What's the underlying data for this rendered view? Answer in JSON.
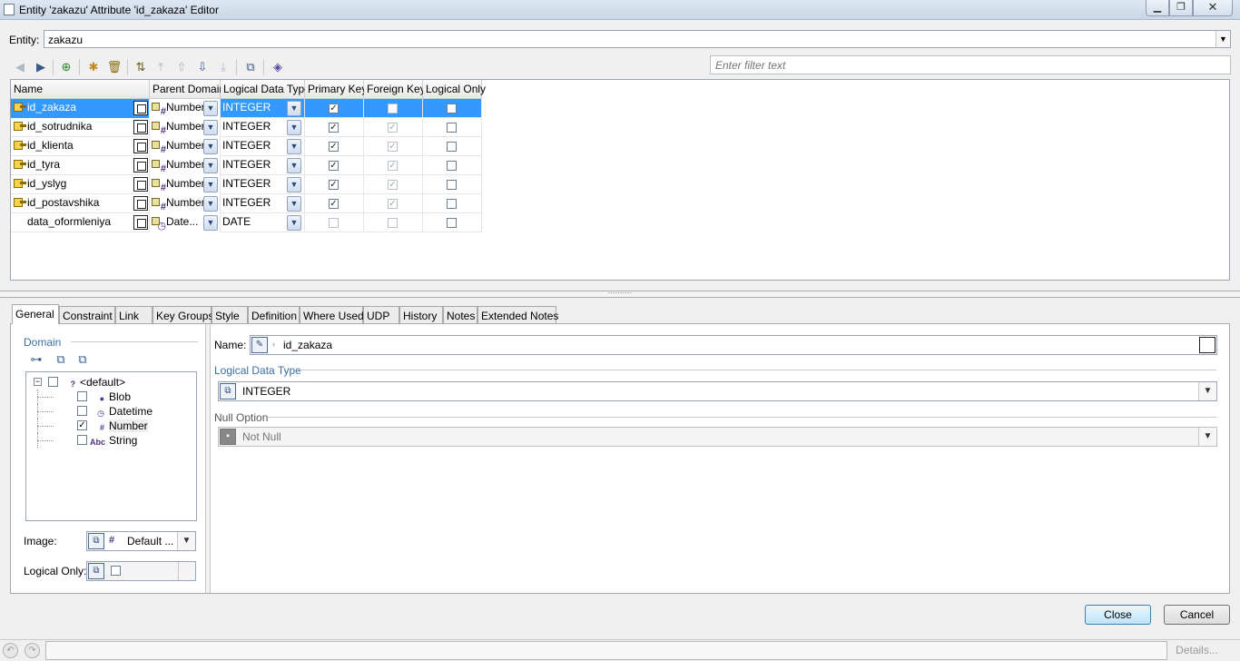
{
  "window": {
    "title": "Entity 'zakazu' Attribute 'id_zakaza' Editor",
    "min_glyph": "▁",
    "max_glyph": "❐",
    "close_glyph": "✕"
  },
  "entity": {
    "label": "Entity:",
    "value": "zakazu"
  },
  "filter": {
    "placeholder": "Enter filter text"
  },
  "grid": {
    "columns": [
      "Name",
      "Parent Domain",
      "Logical Data Type",
      "Primary Key",
      "Foreign Key",
      "Logical Only"
    ],
    "rows": [
      {
        "name": "id_zakaza",
        "domain": "Number",
        "type": "INTEGER",
        "pk": true,
        "fk": false,
        "lo": false,
        "key": true,
        "selected": true
      },
      {
        "name": "id_sotrudnika",
        "domain": "Number",
        "type": "INTEGER",
        "pk": true,
        "fk": true,
        "lo": false,
        "key": true
      },
      {
        "name": "id_klienta",
        "domain": "Number",
        "type": "INTEGER",
        "pk": true,
        "fk": true,
        "lo": false,
        "key": true
      },
      {
        "name": "id_tyra",
        "domain": "Number",
        "type": "INTEGER",
        "pk": true,
        "fk": true,
        "lo": false,
        "key": true
      },
      {
        "name": "id_yslyg",
        "domain": "Number",
        "type": "INTEGER",
        "pk": true,
        "fk": true,
        "lo": false,
        "key": true
      },
      {
        "name": "id_postavshika",
        "domain": "Number",
        "type": "INTEGER",
        "pk": true,
        "fk": true,
        "lo": false,
        "key": true
      },
      {
        "name": "data_oformleniya",
        "domain": "Date...",
        "type": "DATE",
        "pk": false,
        "fk": false,
        "lo": false,
        "key": false
      }
    ]
  },
  "tabs": [
    "General",
    "Constraint",
    "Link",
    "Key Groups",
    "Style",
    "Definition",
    "Where Used",
    "UDP",
    "History",
    "Notes",
    "Extended Notes"
  ],
  "general": {
    "domain_label": "Domain",
    "tree": [
      {
        "label": "<default>",
        "checked": false
      },
      {
        "label": "Blob",
        "checked": false
      },
      {
        "label": "Datetime",
        "checked": false
      },
      {
        "label": "Number",
        "checked": true
      },
      {
        "label": "String",
        "checked": false
      }
    ],
    "image_label": "Image:",
    "image_value": "Default ...",
    "logical_only_label": "Logical Only:",
    "name_label": "Name:",
    "name_value": "id_zakaza",
    "ldt_label": "Logical Data Type",
    "ldt_value": "INTEGER",
    "null_label": "Null Option",
    "null_value": "Not Null"
  },
  "buttons": {
    "close": "Close",
    "cancel": "Cancel",
    "details": "Details..."
  }
}
